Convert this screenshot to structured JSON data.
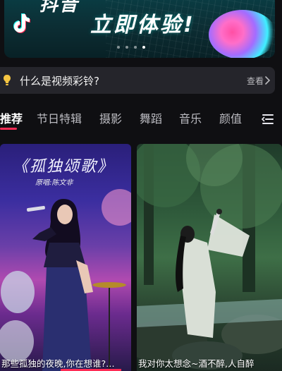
{
  "banner": {
    "headline_top": "抖音",
    "headline": "立即体验!",
    "active_slide": 4,
    "slide_count": 4
  },
  "info_bar": {
    "question": "什么是视频彩铃?",
    "more_label": "查看"
  },
  "tabs": [
    {
      "label": "推荐",
      "active": true
    },
    {
      "label": "节日特辑",
      "active": false
    },
    {
      "label": "摄影",
      "active": false
    },
    {
      "label": "舞蹈",
      "active": false
    },
    {
      "label": "音乐",
      "active": false
    },
    {
      "label": "颜值",
      "active": false
    }
  ],
  "cards": [
    {
      "art_title": "《孤独颂歌》",
      "art_subtitle": "原唱:陈文非",
      "caption": "那些孤独的夜晚,你在想谁?…"
    },
    {
      "caption": "我对你太想念~酒不醉,人自醉"
    }
  ],
  "colors": {
    "accent": "#fe2c55",
    "background": "#0f0f12",
    "info_bar_bg": "#25252b"
  },
  "icons": {
    "bulb": "lightbulb-icon",
    "chevron": "chevron-right-icon",
    "menu": "menu-icon",
    "logo": "tiktok-logo-icon"
  }
}
